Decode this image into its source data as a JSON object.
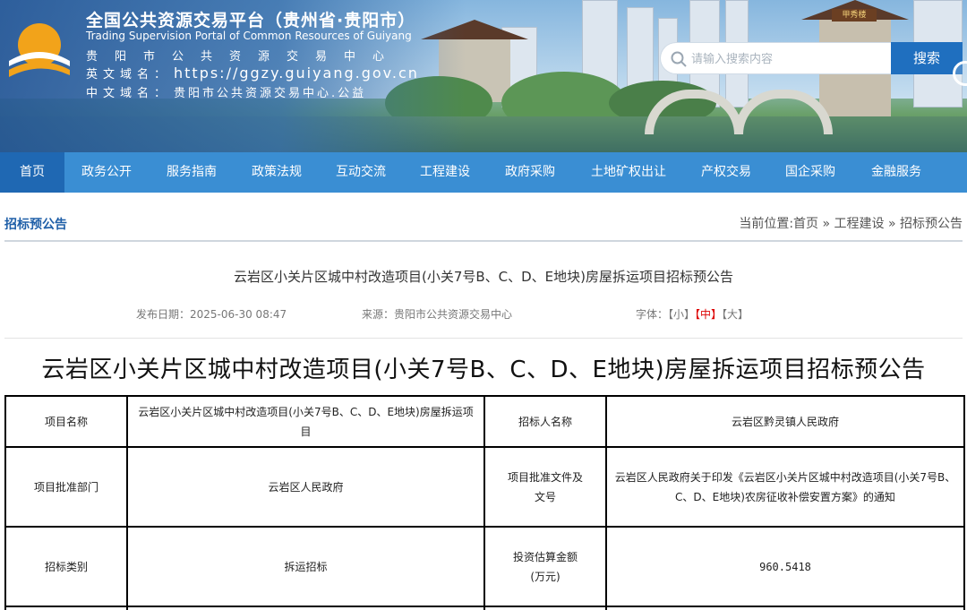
{
  "header": {
    "title_cn": "全国公共资源交易平台（贵州省·贵阳市）",
    "title_en": "Trading Supervision Portal of Common Resources of Guiyang",
    "org_name": "贵阳市公共资源交易中心",
    "domain_en_label": "英文域名：",
    "domain_en_value": "https://ggzy.guiyang.gov.cn",
    "domain_cn_label": "中文域名：",
    "domain_cn_value": "贵阳市公共资源交易中心.公益",
    "logo_icon": "sun-over-waves-logo",
    "banner_sign": "甲秀楼"
  },
  "search": {
    "placeholder": "请输入搜索内容",
    "button_label": "搜索"
  },
  "nav": {
    "items": [
      {
        "label": "首页",
        "active": true
      },
      {
        "label": "政务公开"
      },
      {
        "label": "服务指南"
      },
      {
        "label": "政策法规"
      },
      {
        "label": "互动交流"
      },
      {
        "label": "工程建设"
      },
      {
        "label": "政府采购"
      },
      {
        "label": "土地矿权出让"
      },
      {
        "label": "产权交易"
      },
      {
        "label": "国企采购"
      },
      {
        "label": "金融服务"
      }
    ]
  },
  "section": {
    "title": "招标预公告",
    "breadcrumb": "当前位置:首页 » 工程建设 » 招标预公告"
  },
  "article": {
    "title": "云岩区小关片区城中村改造项目(小关7号B、C、D、E地块)房屋拆运项目招标预公告",
    "date": "发布日期：2025-06-30 08:47",
    "source": "来源：贵阳市公共资源交易中心",
    "font_label": "字体：",
    "font_small": "【小】",
    "font_medium": "【中】",
    "font_large": "【大】",
    "doc_title": "云岩区小关片区城中村改造项目(小关7号B、C、D、E地块)房屋拆运项目招标预公告"
  },
  "table": {
    "rows": [
      [
        "项目名称",
        "云岩区小关片区城中村改造项目(小关7号B、C、D、E地块)房屋拆运项目",
        "招标人名称",
        "云岩区黔灵镇人民政府"
      ],
      [
        "项目批准部门",
        "云岩区人民政府",
        "项目批准文件及文号",
        "云岩区人民政府关于印发《云岩区小关片区城中村改造项目(小关7号B、C、D、E地块)农房征收补偿安置方案》的通知"
      ],
      [
        "招标类别",
        "拆运招标",
        "投资估算金额(万元)",
        "960.5418"
      ]
    ]
  },
  "colors": {
    "nav_bg": "#3a8ed3",
    "nav_active": "#1f68b3",
    "search_button": "#1f6fbf",
    "section_title": "#1f5fa8",
    "font_medium_highlight": "#dd0000"
  }
}
